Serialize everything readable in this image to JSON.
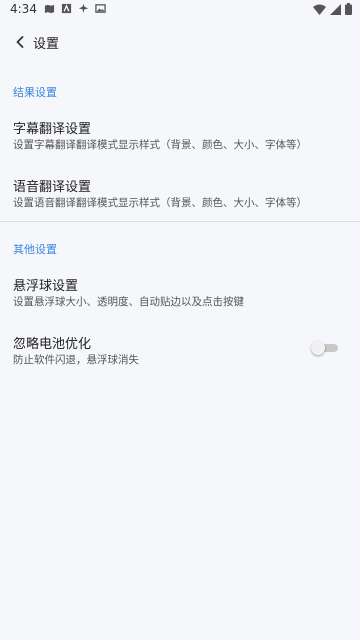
{
  "status_bar": {
    "time": "4:34"
  },
  "app_bar": {
    "title": "设置"
  },
  "sections": [
    {
      "header": "结果设置",
      "items": [
        {
          "title": "字幕翻译设置",
          "subtitle": "设置字幕翻译翻译模式显示样式（背景、颜色、大小、字体等）"
        },
        {
          "title": "语音翻译设置",
          "subtitle": "设置语音翻译翻译模式显示样式（背景、颜色、大小、字体等）"
        }
      ]
    },
    {
      "header": "其他设置",
      "items": [
        {
          "title": "悬浮球设置",
          "subtitle": "设置悬浮球大小、透明度、自动贴边以及点击按键"
        },
        {
          "title": "忽略电池优化",
          "subtitle": "防止软件闪退，悬浮球消失",
          "toggle": false
        }
      ]
    }
  ],
  "colors": {
    "accent": "#3a86e0",
    "background": "#f5f7fa",
    "divider": "#d9dde2"
  },
  "icons": {
    "back": "chevron-left-icon"
  }
}
